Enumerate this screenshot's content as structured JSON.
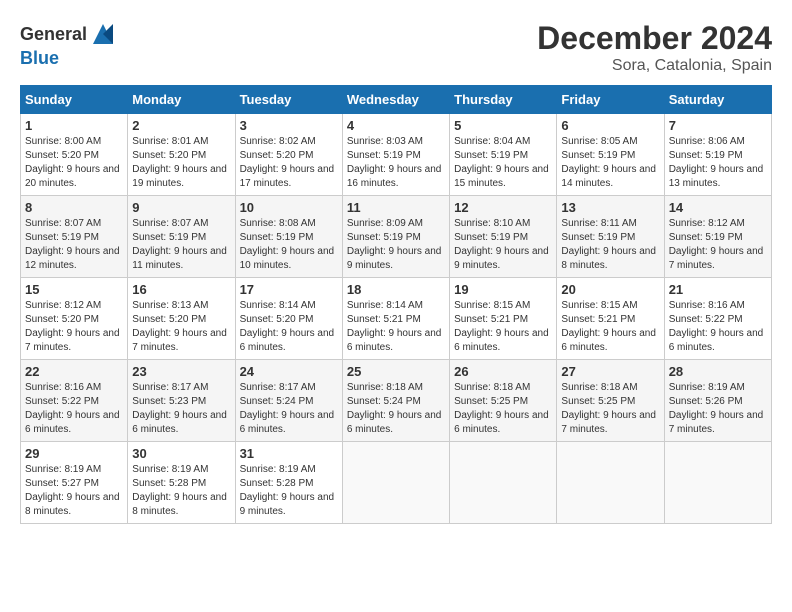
{
  "header": {
    "logo_general": "General",
    "logo_blue": "Blue",
    "title": "December 2024",
    "subtitle": "Sora, Catalonia, Spain"
  },
  "calendar": {
    "days_of_week": [
      "Sunday",
      "Monday",
      "Tuesday",
      "Wednesday",
      "Thursday",
      "Friday",
      "Saturday"
    ],
    "weeks": [
      [
        null,
        {
          "day": 2,
          "sunrise": "8:01 AM",
          "sunset": "5:20 PM",
          "daylight": "9 hours and 19 minutes."
        },
        {
          "day": 3,
          "sunrise": "8:02 AM",
          "sunset": "5:20 PM",
          "daylight": "9 hours and 17 minutes."
        },
        {
          "day": 4,
          "sunrise": "8:03 AM",
          "sunset": "5:19 PM",
          "daylight": "9 hours and 16 minutes."
        },
        {
          "day": 5,
          "sunrise": "8:04 AM",
          "sunset": "5:19 PM",
          "daylight": "9 hours and 15 minutes."
        },
        {
          "day": 6,
          "sunrise": "8:05 AM",
          "sunset": "5:19 PM",
          "daylight": "9 hours and 14 minutes."
        },
        {
          "day": 7,
          "sunrise": "8:06 AM",
          "sunset": "5:19 PM",
          "daylight": "9 hours and 13 minutes."
        }
      ],
      [
        {
          "day": 1,
          "sunrise": "8:00 AM",
          "sunset": "5:20 PM",
          "daylight": "9 hours and 20 minutes."
        },
        {
          "day": 8,
          "sunrise": "8:07 AM",
          "sunset": "5:19 PM",
          "daylight": "9 hours and 12 minutes."
        },
        {
          "day": 9,
          "sunrise": "8:07 AM",
          "sunset": "5:19 PM",
          "daylight": "9 hours and 11 minutes."
        },
        {
          "day": 10,
          "sunrise": "8:08 AM",
          "sunset": "5:19 PM",
          "daylight": "9 hours and 10 minutes."
        },
        {
          "day": 11,
          "sunrise": "8:09 AM",
          "sunset": "5:19 PM",
          "daylight": "9 hours and 9 minutes."
        },
        {
          "day": 12,
          "sunrise": "8:10 AM",
          "sunset": "5:19 PM",
          "daylight": "9 hours and 9 minutes."
        },
        {
          "day": 13,
          "sunrise": "8:11 AM",
          "sunset": "5:19 PM",
          "daylight": "9 hours and 8 minutes."
        },
        {
          "day": 14,
          "sunrise": "8:12 AM",
          "sunset": "5:19 PM",
          "daylight": "9 hours and 7 minutes."
        }
      ],
      [
        {
          "day": 15,
          "sunrise": "8:12 AM",
          "sunset": "5:20 PM",
          "daylight": "9 hours and 7 minutes."
        },
        {
          "day": 16,
          "sunrise": "8:13 AM",
          "sunset": "5:20 PM",
          "daylight": "9 hours and 7 minutes."
        },
        {
          "day": 17,
          "sunrise": "8:14 AM",
          "sunset": "5:20 PM",
          "daylight": "9 hours and 6 minutes."
        },
        {
          "day": 18,
          "sunrise": "8:14 AM",
          "sunset": "5:21 PM",
          "daylight": "9 hours and 6 minutes."
        },
        {
          "day": 19,
          "sunrise": "8:15 AM",
          "sunset": "5:21 PM",
          "daylight": "9 hours and 6 minutes."
        },
        {
          "day": 20,
          "sunrise": "8:15 AM",
          "sunset": "5:21 PM",
          "daylight": "9 hours and 6 minutes."
        },
        {
          "day": 21,
          "sunrise": "8:16 AM",
          "sunset": "5:22 PM",
          "daylight": "9 hours and 6 minutes."
        }
      ],
      [
        {
          "day": 22,
          "sunrise": "8:16 AM",
          "sunset": "5:22 PM",
          "daylight": "9 hours and 6 minutes."
        },
        {
          "day": 23,
          "sunrise": "8:17 AM",
          "sunset": "5:23 PM",
          "daylight": "9 hours and 6 minutes."
        },
        {
          "day": 24,
          "sunrise": "8:17 AM",
          "sunset": "5:24 PM",
          "daylight": "9 hours and 6 minutes."
        },
        {
          "day": 25,
          "sunrise": "8:18 AM",
          "sunset": "5:24 PM",
          "daylight": "9 hours and 6 minutes."
        },
        {
          "day": 26,
          "sunrise": "8:18 AM",
          "sunset": "5:25 PM",
          "daylight": "9 hours and 6 minutes."
        },
        {
          "day": 27,
          "sunrise": "8:18 AM",
          "sunset": "5:25 PM",
          "daylight": "9 hours and 7 minutes."
        },
        {
          "day": 28,
          "sunrise": "8:19 AM",
          "sunset": "5:26 PM",
          "daylight": "9 hours and 7 minutes."
        }
      ],
      [
        {
          "day": 29,
          "sunrise": "8:19 AM",
          "sunset": "5:27 PM",
          "daylight": "9 hours and 8 minutes."
        },
        {
          "day": 30,
          "sunrise": "8:19 AM",
          "sunset": "5:28 PM",
          "daylight": "9 hours and 8 minutes."
        },
        {
          "day": 31,
          "sunrise": "8:19 AM",
          "sunset": "5:28 PM",
          "daylight": "9 hours and 9 minutes."
        },
        null,
        null,
        null,
        null
      ]
    ]
  }
}
